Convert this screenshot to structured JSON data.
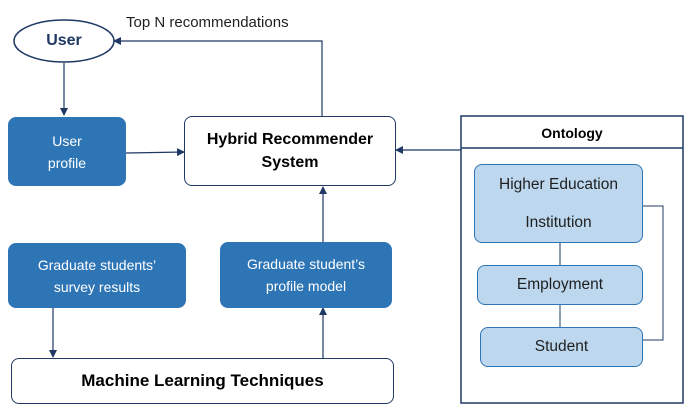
{
  "nodes": {
    "user": "User",
    "user_profile": "User\nprofile",
    "hybrid": "Hybrid Recommender\nSystem",
    "survey": "Graduate students’\nsurvey results",
    "profile_model": "Graduate student’s\nprofile model",
    "ml": "Machine Learning Techniques",
    "ontology_title": "Ontology",
    "hei": "Higher Education\n\nInstitution",
    "employment": "Employment",
    "student": "Student"
  },
  "edges": {
    "top_n": "Top N recommendations"
  },
  "colors": {
    "dark_box": "#2e75b6",
    "light_box": "#bdd7ee",
    "outline": "#1f3864"
  }
}
